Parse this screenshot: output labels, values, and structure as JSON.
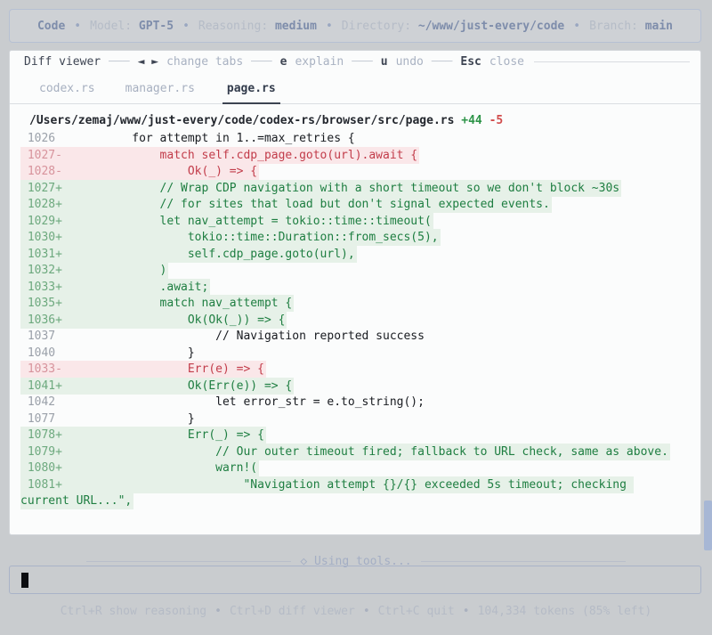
{
  "colors": {
    "background": "#c9cccf",
    "accent_blue": "#7e8dab",
    "added_green": "#1e7e41",
    "added_bg": "#e6f1e8",
    "removed_red": "#c23c4a",
    "removed_bg": "#fae7e9",
    "scrollbar_thumb": "#a7b7d5"
  },
  "top_bar": {
    "separator": "•",
    "items": [
      {
        "label": "",
        "value": "Code"
      },
      {
        "label": "Model: ",
        "value": "GPT-5"
      },
      {
        "label": "Reasoning: ",
        "value": "medium"
      },
      {
        "label": "Directory: ",
        "value": "~/www/just-every/code"
      },
      {
        "label": "Branch: ",
        "value": "main"
      }
    ]
  },
  "diff_viewer": {
    "title": "Diff viewer",
    "dash": "───",
    "shortcuts": [
      {
        "keys": "◄ ►",
        "label": "change tabs"
      },
      {
        "keys": "e",
        "label": "explain"
      },
      {
        "keys": "u",
        "label": "undo"
      },
      {
        "keys": "Esc",
        "label": "close"
      }
    ],
    "tabs": [
      {
        "label": "codex.rs",
        "active": false
      },
      {
        "label": "manager.rs",
        "active": false
      },
      {
        "label": "page.rs",
        "active": true
      }
    ],
    "file": {
      "path": "/Users/zemaj/www/just-every/code/codex-rs/browser/src/page.rs ",
      "additions": "+44",
      "deletions": " -5"
    },
    "lines": [
      {
        "num": "1026",
        "sign": "",
        "type": "context",
        "code": "        for attempt in 1..=max_retries {"
      },
      {
        "num": "1027",
        "sign": "-",
        "type": "removed",
        "code": "            match self.cdp_page.goto(url).await {"
      },
      {
        "num": "1028",
        "sign": "-",
        "type": "removed",
        "code": "                Ok(_) => {"
      },
      {
        "num": "1027",
        "sign": "+",
        "type": "added",
        "code": "            // Wrap CDP navigation with a short timeout so we don't block ~30s"
      },
      {
        "num": "1028",
        "sign": "+",
        "type": "added",
        "code": "            // for sites that load but don't signal expected events."
      },
      {
        "num": "1029",
        "sign": "+",
        "type": "added",
        "code": "            let nav_attempt = tokio::time::timeout("
      },
      {
        "num": "1030",
        "sign": "+",
        "type": "added",
        "code": "                tokio::time::Duration::from_secs(5),"
      },
      {
        "num": "1031",
        "sign": "+",
        "type": "added",
        "code": "                self.cdp_page.goto(url),"
      },
      {
        "num": "1032",
        "sign": "+",
        "type": "added",
        "code": "            )"
      },
      {
        "num": "1033",
        "sign": "+",
        "type": "added",
        "code": "            .await;"
      },
      {
        "num": "1035",
        "sign": "+",
        "type": "added",
        "code": "            match nav_attempt {"
      },
      {
        "num": "1036",
        "sign": "+",
        "type": "added",
        "code": "                Ok(Ok(_)) => {"
      },
      {
        "num": "1037",
        "sign": "",
        "type": "context",
        "code": "                    // Navigation reported success"
      },
      {
        "num": "1040",
        "sign": "",
        "type": "context",
        "code": "                }"
      },
      {
        "num": "1033",
        "sign": "-",
        "type": "removed",
        "code": "                Err(e) => {"
      },
      {
        "num": "1041",
        "sign": "+",
        "type": "added",
        "code": "                Ok(Err(e)) => {"
      },
      {
        "num": "1042",
        "sign": "",
        "type": "context",
        "code": "                    let error_str = e.to_string();"
      },
      {
        "num": "1077",
        "sign": "",
        "type": "context",
        "code": "                }"
      },
      {
        "num": "1078",
        "sign": "+",
        "type": "added",
        "code": "                Err(_) => {"
      },
      {
        "num": "1079",
        "sign": "+",
        "type": "added",
        "code": "                    // Our outer timeout fired; fallback to URL check, same as above."
      },
      {
        "num": "1080",
        "sign": "+",
        "type": "added",
        "code": "                    warn!("
      },
      {
        "num": "1081",
        "sign": "+",
        "type": "added",
        "code": "                        \"Navigation attempt {}/{} exceeded 5s timeout; checking current URL...\","
      }
    ]
  },
  "status_line": {
    "icon": "◇",
    "text": "Using tools..."
  },
  "footer": {
    "separator": "•",
    "hints": [
      {
        "key": "Ctrl+R",
        "label": " show reasoning"
      },
      {
        "key": "Ctrl+D",
        "label": " diff viewer"
      },
      {
        "key": "Ctrl+C",
        "label": " quit"
      }
    ],
    "tokens": "104,334 tokens (85% left)"
  }
}
